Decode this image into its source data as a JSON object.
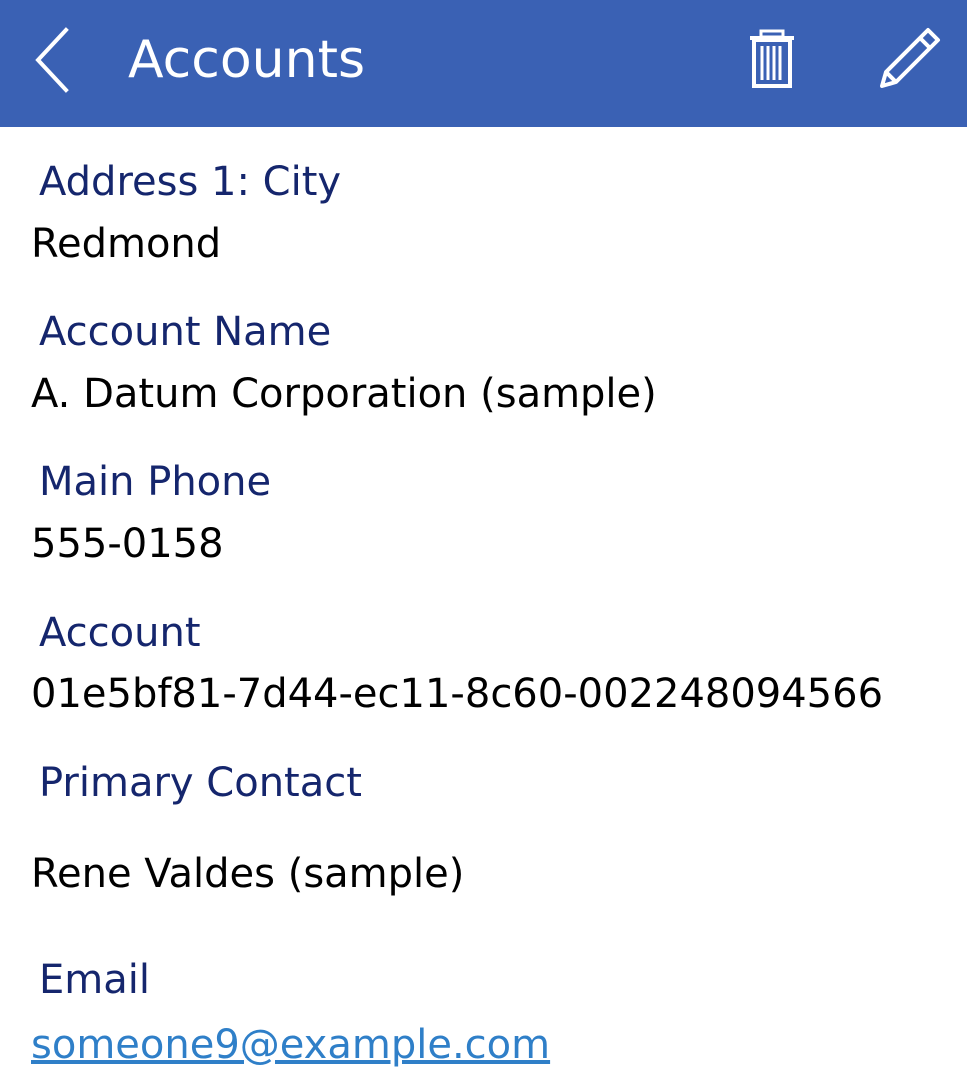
{
  "header": {
    "title": "Accounts",
    "background_color": "#3a61b4",
    "back_icon": "chevron-left-icon",
    "delete_icon": "trash-icon",
    "edit_icon": "pencil-icon"
  },
  "fields": [
    {
      "label": "Address 1: City",
      "value": "Redmond"
    },
    {
      "label": "Account Name",
      "value": "A. Datum Corporation (sample)"
    },
    {
      "label": "Main Phone",
      "value": "555-0158"
    },
    {
      "label": "Account",
      "value": "01e5bf81-7d44-ec11-8c60-002248094566"
    },
    {
      "label": "Primary Contact",
      "value": "Rene Valdes (sample)"
    },
    {
      "label": "Email",
      "value": "someone9@example.com"
    }
  ],
  "colors": {
    "label": "#15266d",
    "value": "#000000",
    "link": "#2f7fc8"
  }
}
